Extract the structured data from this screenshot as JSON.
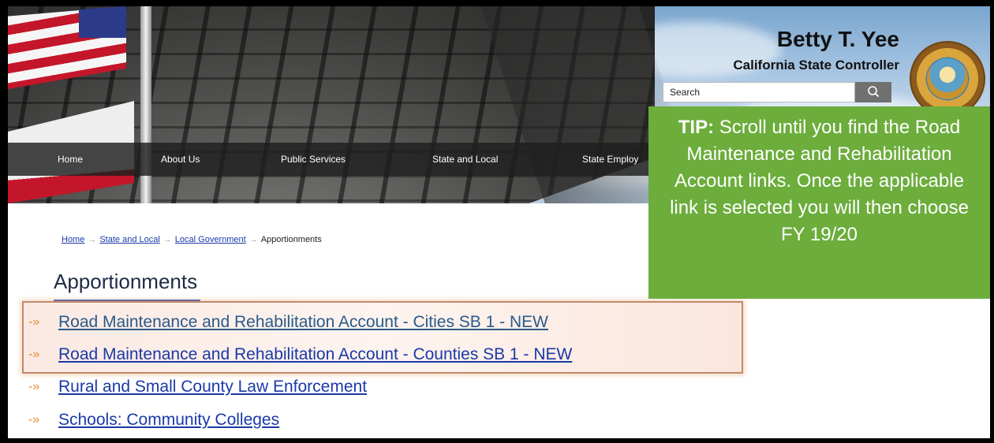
{
  "header": {
    "name": "Betty T. Yee",
    "subtitle": "California State Controller",
    "search_placeholder": "Search",
    "search_icon": "search-icon"
  },
  "nav": {
    "items": [
      "Home",
      "About Us",
      "Public Services",
      "State and Local",
      "State Employ"
    ]
  },
  "breadcrumb": {
    "items": [
      "Home",
      "State and Local",
      "Local Government"
    ],
    "current": "Apportionments",
    "separator": "→"
  },
  "page": {
    "title": "Apportionments"
  },
  "links": [
    {
      "label": "Road Maintenance and Rehabilitation Account - Cities SB 1 - NEW",
      "highlighted": true
    },
    {
      "label": "Road Maintenance and Rehabilitation Account - Counties SB 1 - NEW",
      "highlighted": true
    },
    {
      "label": "Rural and Small County Law Enforcement",
      "highlighted": false
    },
    {
      "label": "Schools: Community Colleges",
      "highlighted": false
    }
  ],
  "tip": {
    "prefix": "TIP:",
    "text": " Scroll until you find the Road Maintenance and Rehabilitation Account links. Once the applicable link is selected you will then choose FY 19/20"
  },
  "colors": {
    "tip_bg": "#6cad3c",
    "link": "#1a39a8",
    "arrow": "#e68a2e",
    "nav_bg": "#1e1e1e"
  }
}
